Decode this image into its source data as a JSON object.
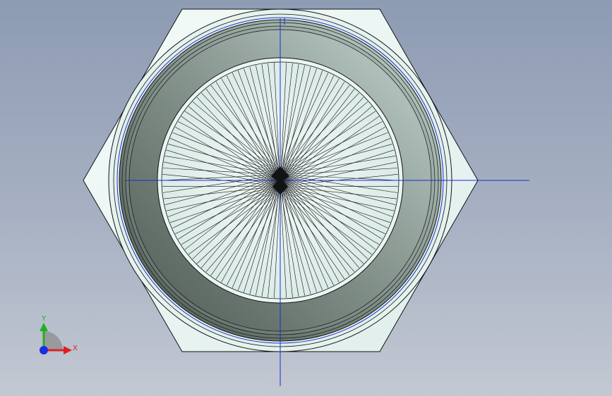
{
  "viewport": {
    "view_orientation": "front"
  },
  "model": {
    "part": "hex-fitting",
    "face_count_radial": 120
  },
  "triad": {
    "x_label": "X",
    "y_label": "Y",
    "x_color": "#e02020",
    "y_color": "#20b020",
    "z_color": "#1a2fe0"
  },
  "colors": {
    "hex_face": "#eef7f5",
    "ring_outer": "#e4f1ee",
    "cone_dark": "#66726c",
    "cone_light": "#b4c6c0",
    "inner_face": "#e7f4f1",
    "edge": "#101414",
    "center_line": "#1a2fd0"
  }
}
